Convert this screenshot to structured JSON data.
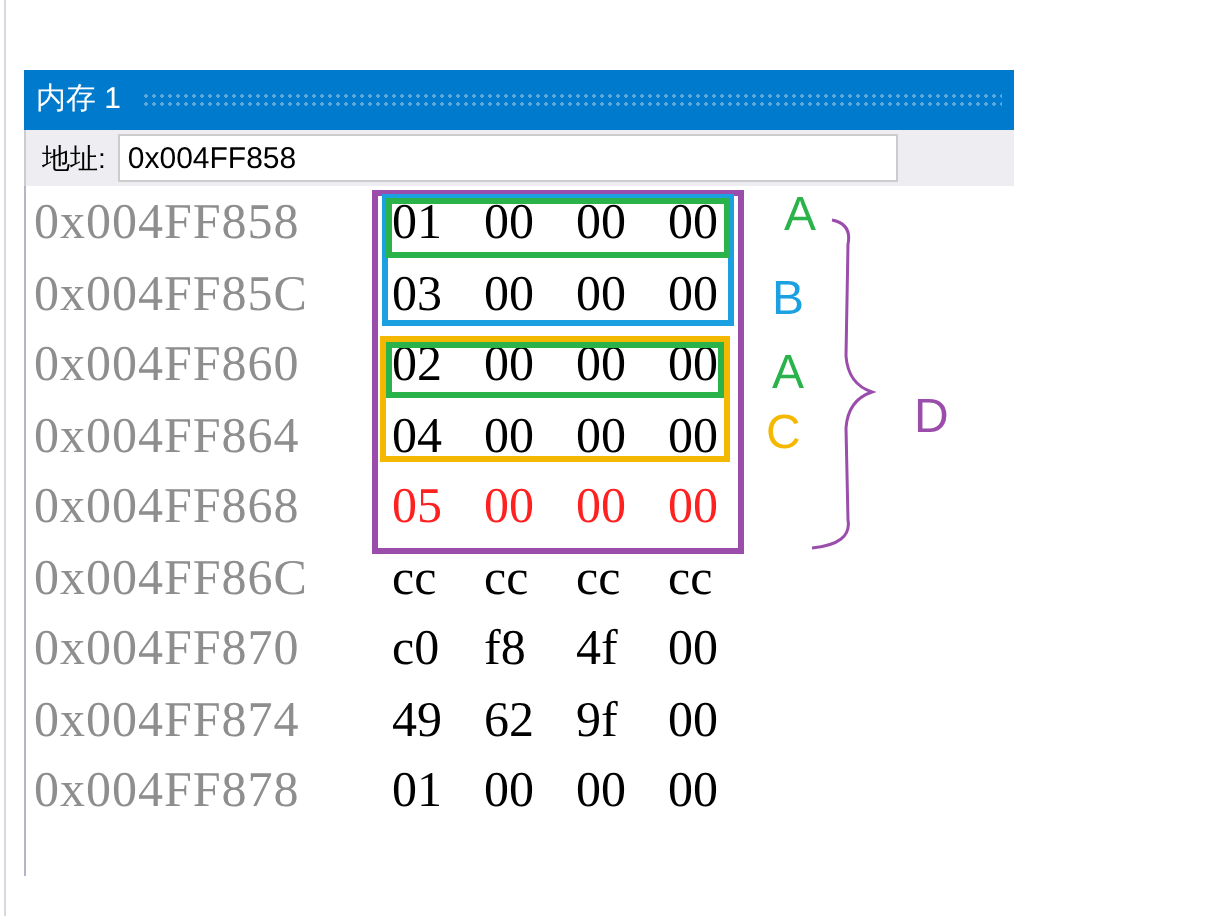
{
  "window": {
    "title": "内存 1"
  },
  "address_bar": {
    "label": "地址:",
    "value": "0x004FF858"
  },
  "rows": [
    {
      "address": "0x004FF858",
      "bytes": [
        "01",
        "00",
        "00",
        "00"
      ],
      "changed": false
    },
    {
      "address": "0x004FF85C",
      "bytes": [
        "03",
        "00",
        "00",
        "00"
      ],
      "changed": false
    },
    {
      "address": "0x004FF860",
      "bytes": [
        "02",
        "00",
        "00",
        "00"
      ],
      "changed": false
    },
    {
      "address": "0x004FF864",
      "bytes": [
        "04",
        "00",
        "00",
        "00"
      ],
      "changed": false
    },
    {
      "address": "0x004FF868",
      "bytes": [
        "05",
        "00",
        "00",
        "00"
      ],
      "changed": true
    },
    {
      "address": "0x004FF86C",
      "bytes": [
        "cc",
        "cc",
        "cc",
        "cc"
      ],
      "changed": false
    },
    {
      "address": "0x004FF870",
      "bytes": [
        "c0",
        "f8",
        "4f",
        "00"
      ],
      "changed": false
    },
    {
      "address": "0x004FF874",
      "bytes": [
        "49",
        "62",
        "9f",
        "00"
      ],
      "changed": false
    },
    {
      "address": "0x004FF878",
      "bytes": [
        "01",
        "00",
        "00",
        "00"
      ],
      "changed": false
    }
  ],
  "annotations": {
    "boxes": [
      {
        "color": "#9b4dab"
      },
      {
        "color": "#1ba1e2"
      },
      {
        "color": "#f5b800"
      },
      {
        "color": "#2ab34a"
      },
      {
        "color": "#2ab34a"
      }
    ],
    "labels": [
      {
        "text": "A",
        "color": "#2ab34a"
      },
      {
        "text": "B",
        "color": "#1ba1e2"
      },
      {
        "text": "A",
        "color": "#2ab34a"
      },
      {
        "text": "C",
        "color": "#f5b800"
      },
      {
        "text": "D",
        "color": "#9b4dab"
      }
    ]
  }
}
